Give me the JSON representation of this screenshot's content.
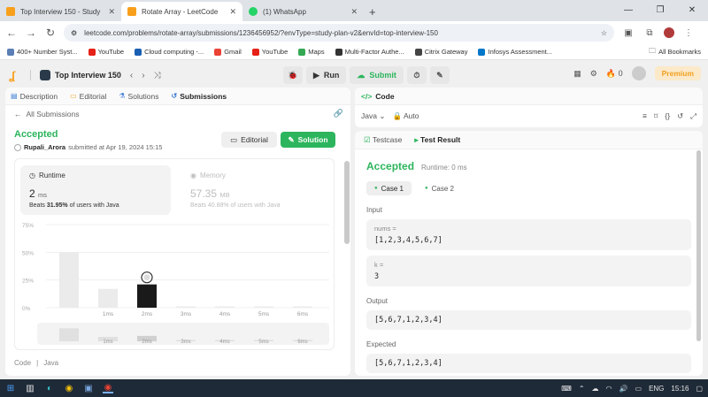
{
  "browser": {
    "tabs": [
      {
        "title": "Top Interview 150 - Study Plan",
        "fav_color": "#f89f1b",
        "active": false
      },
      {
        "title": "Rotate Array - LeetCode",
        "fav_color": "#f89f1b",
        "active": true
      },
      {
        "title": "(1) WhatsApp",
        "fav_color": "#25d366",
        "active": false
      }
    ],
    "url": "leetcode.com/problems/rotate-array/submissions/1236456952/?envType=study-plan-v2&envId=top-interview-150",
    "bookmarks": [
      "400+ Number Syst...",
      "YouTube",
      "Cloud computing -...",
      "Gmail",
      "YouTube",
      "Maps",
      "Multi-Factor Authe...",
      "Citrix Gateway",
      "Infosys Assessment..."
    ],
    "all_bookmarks": "All Bookmarks",
    "ext_badge": "0"
  },
  "header": {
    "list_name": "Top Interview 150",
    "run": "Run",
    "submit": "Submit",
    "streak": "0",
    "premium": "Premium"
  },
  "left": {
    "tabs": [
      "Description",
      "Editorial",
      "Solutions",
      "Submissions"
    ],
    "all_submissions": "All Submissions",
    "status": "Accepted",
    "user": "Rupali_Arora",
    "submitted": "submitted at Apr 19, 2024 15:15",
    "editorial_btn": "Editorial",
    "solution_btn": "Solution",
    "runtime": {
      "label": "Runtime",
      "value": "2",
      "unit": "ms",
      "beats_prefix": "Beats",
      "beats_value": "31.95%",
      "beats_suffix": "of users with Java"
    },
    "memory": {
      "label": "Memory",
      "value": "57.35",
      "unit": "MB",
      "beats": "Beats 40.88% of users with Java"
    },
    "footer": [
      "Code",
      "Java"
    ]
  },
  "chart_data": {
    "type": "bar",
    "categories": [
      "",
      "1ms",
      "2ms",
      "3ms",
      "4ms",
      "5ms",
      "6ms"
    ],
    "values": [
      50,
      17,
      21,
      1,
      1,
      1,
      1
    ],
    "highlight_index": 2,
    "yticks": [
      "75%",
      "50%",
      "25%",
      "0%"
    ],
    "ylim": [
      0,
      75
    ],
    "colors": {
      "normal": "#ebebeb",
      "highlight": "#1a1a1a"
    }
  },
  "code": {
    "title": "Code",
    "lang": "Java",
    "mode": "Auto"
  },
  "result": {
    "tabs": [
      "Testcase",
      "Test Result"
    ],
    "status": "Accepted",
    "runtime": "Runtime: 0 ms",
    "cases": [
      "Case 1",
      "Case 2"
    ],
    "input_label": "Input",
    "inputs": [
      {
        "name": "nums =",
        "value": "[1,2,3,4,5,6,7]"
      },
      {
        "name": "k =",
        "value": "3"
      }
    ],
    "output_label": "Output",
    "output": "[5,6,7,1,2,3,4]",
    "expected_label": "Expected",
    "expected": "[5,6,7,1,2,3,4]"
  },
  "taskbar": {
    "lang": "ENG",
    "time": "15:16"
  }
}
